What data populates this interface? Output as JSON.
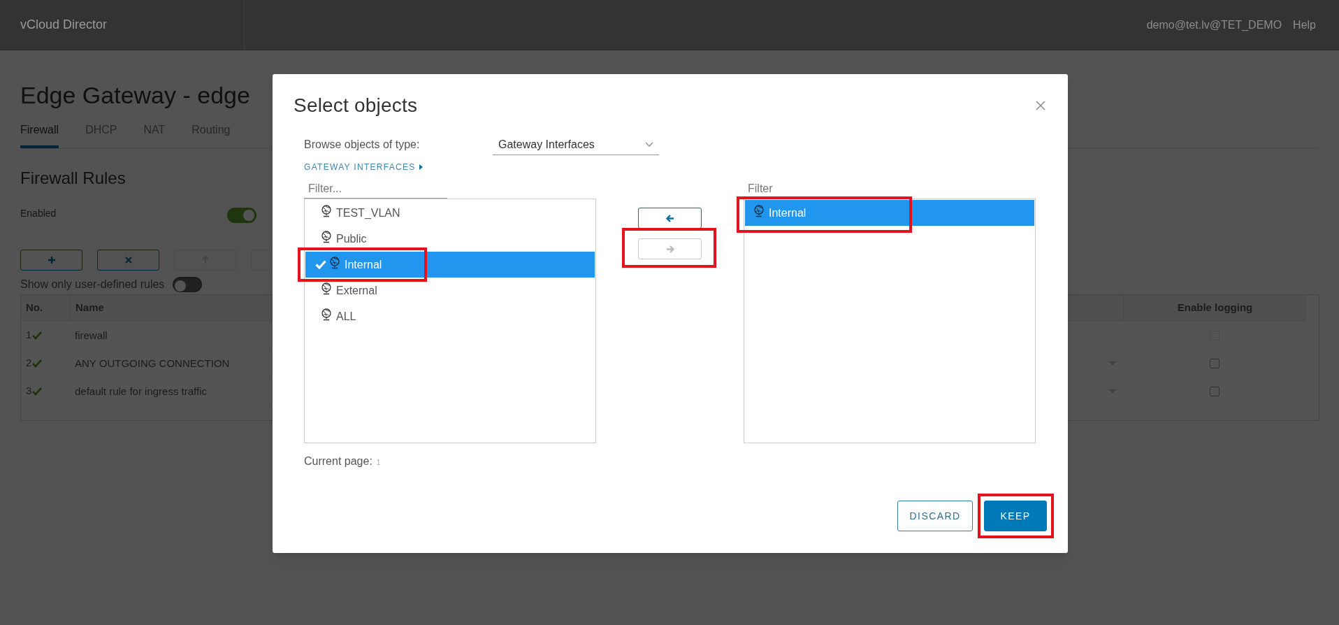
{
  "header": {
    "brand": "vCloud Director",
    "user": "demo@tet.lv@TET_DEMO",
    "help": "Help"
  },
  "page": {
    "title": "Edge Gateway - edge",
    "tabs": [
      {
        "label": "Firewall",
        "selected": true
      },
      {
        "label": "DHCP",
        "selected": false
      },
      {
        "label": "NAT",
        "selected": false
      },
      {
        "label": "Routing",
        "selected": false
      }
    ],
    "section_title": "Firewall Rules",
    "enabled_toggle": {
      "label": "Enabled",
      "on": true
    },
    "toolbar": [
      {
        "kind": "add",
        "disabled": false
      },
      {
        "kind": "delete",
        "disabled": false
      },
      {
        "kind": "move_up",
        "disabled": true
      }
    ],
    "user_rules_toggle": {
      "label": "Show only user-defined rules",
      "on": false
    },
    "table": {
      "columns": [
        "No.",
        "Name",
        "Enable logging"
      ],
      "rows": [
        {
          "no": "1",
          "name": "firewall",
          "active": true,
          "has_dropdown": false,
          "logging": false,
          "logging_disabled": true
        },
        {
          "no": "2",
          "name": "ANY OUTGOING CONNECTION",
          "active": true,
          "has_dropdown": true,
          "logging": false,
          "logging_disabled": false
        },
        {
          "no": "3",
          "name": "default rule for ingress traffic",
          "active": true,
          "has_dropdown": true,
          "logging": false,
          "logging_disabled": false
        }
      ]
    }
  },
  "modal": {
    "title": "Select objects",
    "type_label": "Browse objects of type:",
    "type_value": "Gateway Interfaces",
    "breadcrumb": "GATEWAY INTERFACES",
    "available": {
      "filter_placeholder": "Filter...",
      "items": [
        {
          "label": "TEST_VLAN",
          "selected": false,
          "annotated": false
        },
        {
          "label": "Public",
          "selected": false,
          "annotated": false
        },
        {
          "label": "Internal",
          "selected": true,
          "annotated": true
        },
        {
          "label": "External",
          "selected": false,
          "annotated": false
        },
        {
          "label": "ALL",
          "selected": false,
          "annotated": false
        }
      ]
    },
    "transfer_buttons": [
      {
        "kind": "move_left",
        "disabled": false,
        "annotated": false
      },
      {
        "kind": "move_right",
        "disabled": true,
        "annotated": true
      }
    ],
    "chosen": {
      "filter_placeholder": "Filter",
      "items": [
        {
          "label": "Internal",
          "selected": true,
          "annotated": true
        }
      ]
    },
    "pagination": {
      "label": "Current page:",
      "value": "1"
    },
    "actions": [
      {
        "label": "DISCARD",
        "kind": "secondary",
        "annotated": false
      },
      {
        "label": "KEEP",
        "kind": "primary",
        "annotated": true
      }
    ]
  }
}
